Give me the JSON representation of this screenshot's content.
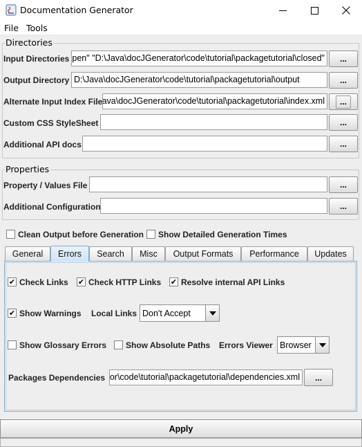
{
  "window": {
    "title": "Documentation Generator",
    "minimize_glyph": "—",
    "maximize_glyph": "☐",
    "close_glyph": "✕"
  },
  "menu": [
    "File",
    "Tools"
  ],
  "directories": {
    "title": "Directories",
    "input_label": "Input Directories",
    "input_value": "\\open\" \"D:\\Java\\docJGenerator\\code\\tutorial\\packagetutorial\\closed\"",
    "output_label": "Output Directory",
    "output_value": "D:\\Java\\docJGenerator\\code\\tutorial\\packagetutorial\\output",
    "alt_index_label": "Alternate Input Index File",
    "alt_index_value": "Java\\docJGenerator\\code\\tutorial\\packagetutorial\\index.xml",
    "css_label": "Custom CSS StyleSheet",
    "css_value": "",
    "api_label": "Additional API docs",
    "api_value": "",
    "browse_label": "..."
  },
  "properties": {
    "title": "Properties",
    "values_file_label": "Property / Values File",
    "values_file_value": "",
    "config_label": "Additional Configuration",
    "config_value": ""
  },
  "options": {
    "clean_output_label": "Clean Output before Generation",
    "clean_output_checked": false,
    "detailed_times_label": "Show Detailed Generation Times",
    "detailed_times_checked": false
  },
  "tabs": [
    "General",
    "Errors",
    "Search",
    "Misc",
    "Output Formats",
    "Performance",
    "Updates"
  ],
  "active_tab": "Errors",
  "errors_tab": {
    "check_links_label": "Check Links",
    "check_links_checked": true,
    "check_http_label": "Check HTTP Links",
    "check_http_checked": true,
    "resolve_api_label": "Resolve internal API Links",
    "resolve_api_checked": true,
    "show_warnings_label": "Show Warnings",
    "show_warnings_checked": true,
    "local_links_label": "Local Links",
    "local_links_value": "Don't Accept",
    "glossary_errors_label": "Show Glossary Errors",
    "glossary_errors_checked": false,
    "absolute_paths_label": "Show Absolute Paths",
    "absolute_paths_checked": false,
    "errors_viewer_label": "Errors Viewer",
    "errors_viewer_value": "Browser",
    "packages_deps_label": "Packages Dependencies",
    "packages_deps_value": "tor\\code\\tutorial\\packagetutorial\\dependencies.xml"
  },
  "apply_label": "Apply",
  "check_glyph": "✔"
}
